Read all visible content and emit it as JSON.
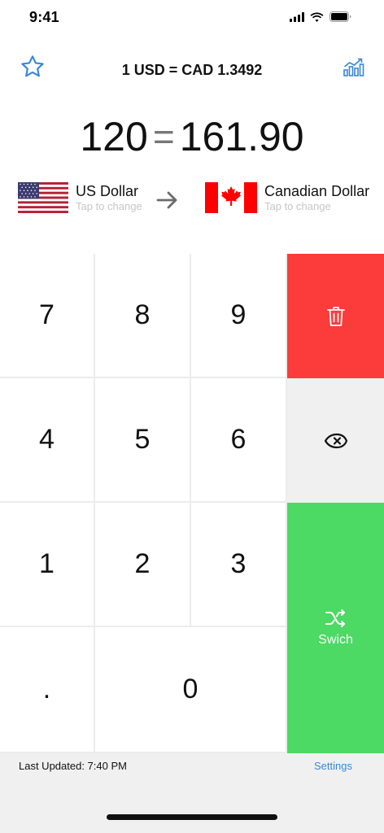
{
  "status_bar": {
    "time": "9:41"
  },
  "header": {
    "rate": "1 USD = CAD 1.3492"
  },
  "conversion": {
    "amount": "120",
    "equals": "=",
    "result": "161.90"
  },
  "currencies": {
    "from": {
      "name": "US Dollar",
      "hint": "Tap to change",
      "flag": "us-flag"
    },
    "to": {
      "name": "Canadian Dollar",
      "hint": "Tap to change",
      "flag": "ca-flag"
    }
  },
  "keypad": {
    "keys": [
      "7",
      "8",
      "9",
      "4",
      "5",
      "6",
      "1",
      "2",
      "3",
      ".",
      "0"
    ],
    "switch_label": "Swich"
  },
  "footer": {
    "last_updated": "Last Updated: 7:40 PM",
    "settings": "Settings"
  },
  "colors": {
    "accent": "#3a87d6",
    "clear": "#fc3b3b",
    "switch": "#4cd964",
    "backspace_bg": "#f0f0f0"
  }
}
